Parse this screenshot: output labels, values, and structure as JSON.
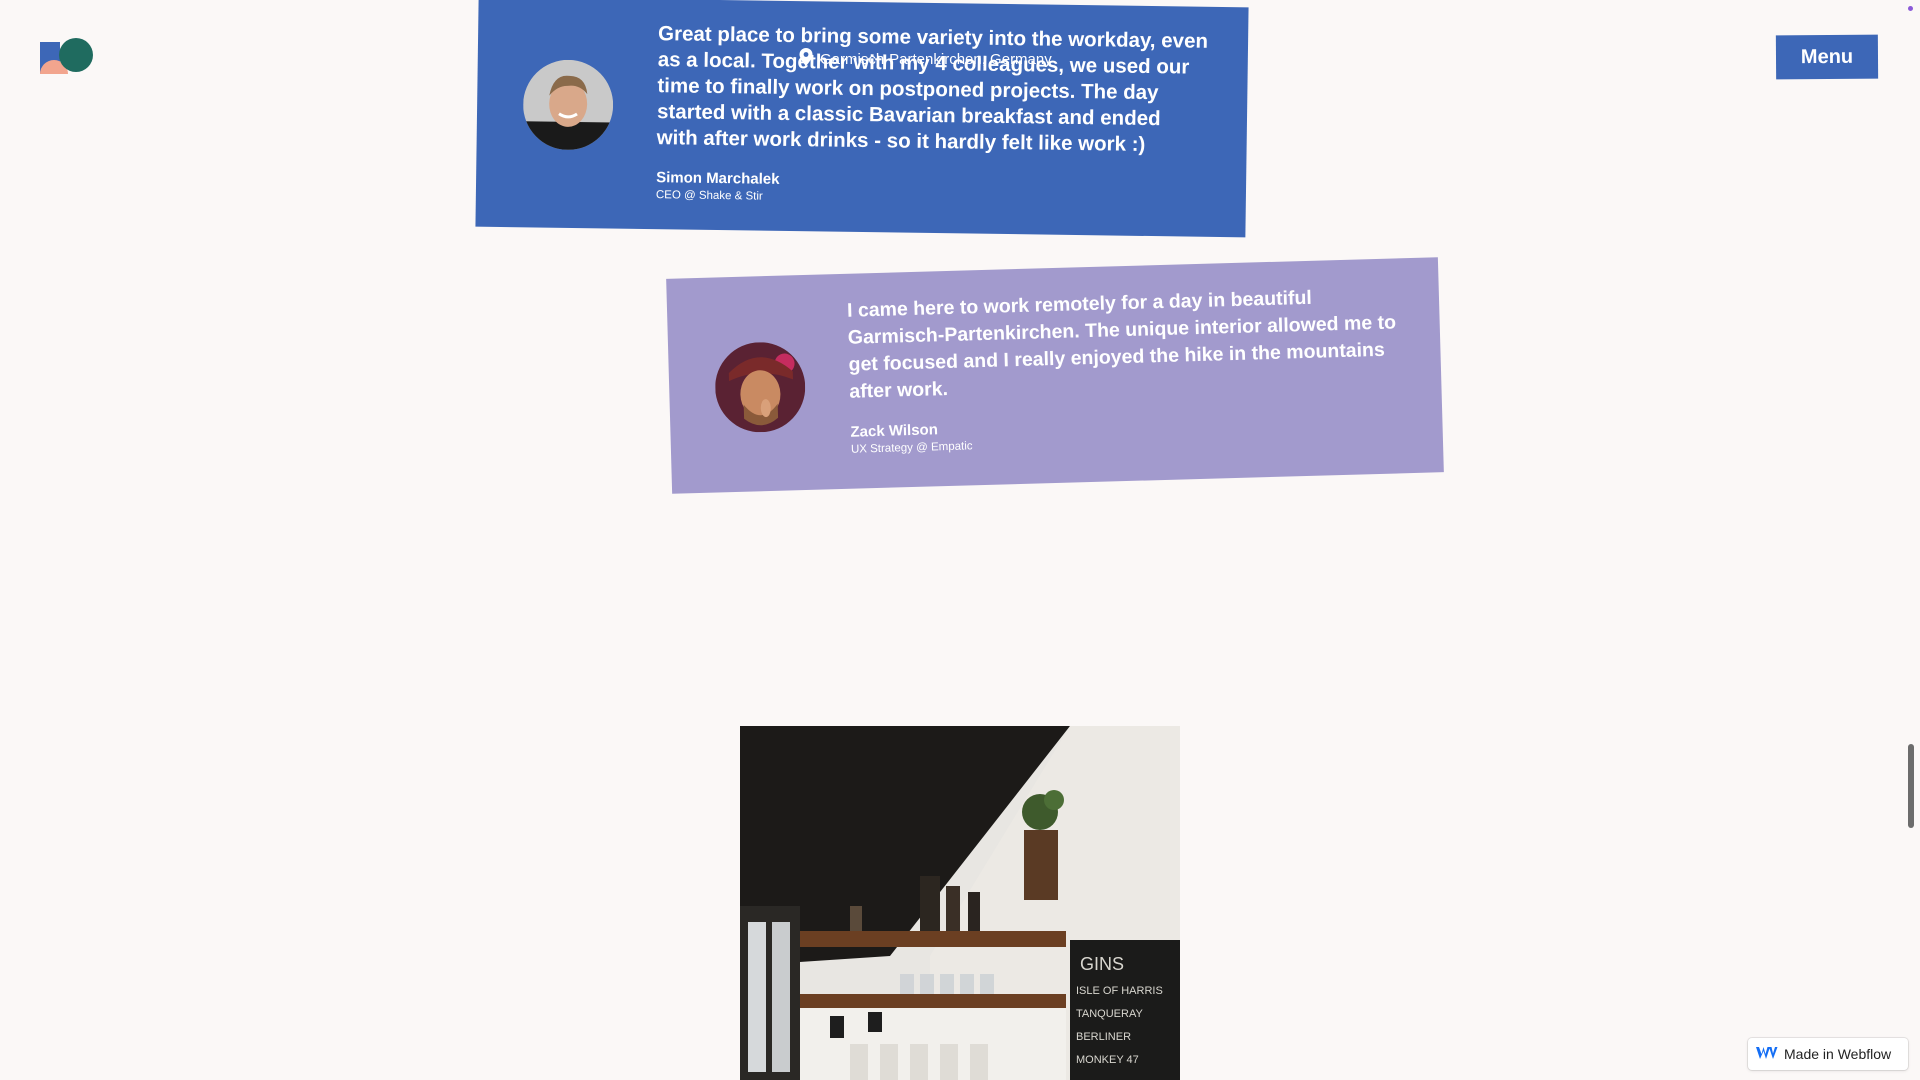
{
  "header": {
    "logo_icon": "brand-logo-icon",
    "menu_label": "Menu"
  },
  "location": {
    "icon": "map-pin-icon",
    "text": "Garmisch-Partenkirchen, Germany"
  },
  "testimonials": [
    {
      "quote": "Great place to bring some variety into the workday, even as a local. Together with my 4 colleagues, we used our time to finally work on postponed projects. The day started with a classic Bavarian breakfast and ended with after work drinks - so it hardly felt like work :)",
      "name": "Simon Marchalek",
      "role": "CEO @ Shake & Stir",
      "background_color": "#3d67b7"
    },
    {
      "quote": "I came here to work remotely for a day in beautiful Garmisch-Partenkirchen. The unique interior allowed me to get focused and I really enjoyed the hike in the mountains after work.",
      "name": "Zack Wilson",
      "role": "UX Strategy @ Empatic",
      "background_color": "#a29acd"
    }
  ],
  "photo": {
    "chalkboard_lines": [
      "GINS",
      "ISLE OF HARRIS",
      "TANQUERAY",
      "BERLINER",
      "MONKEY 47"
    ]
  },
  "badge": {
    "icon": "webflow-logo-icon",
    "label": "Made in Webflow"
  },
  "colors": {
    "background": "#fbf8f7",
    "primary_blue": "#3d67b7",
    "lavender": "#a29acd"
  }
}
